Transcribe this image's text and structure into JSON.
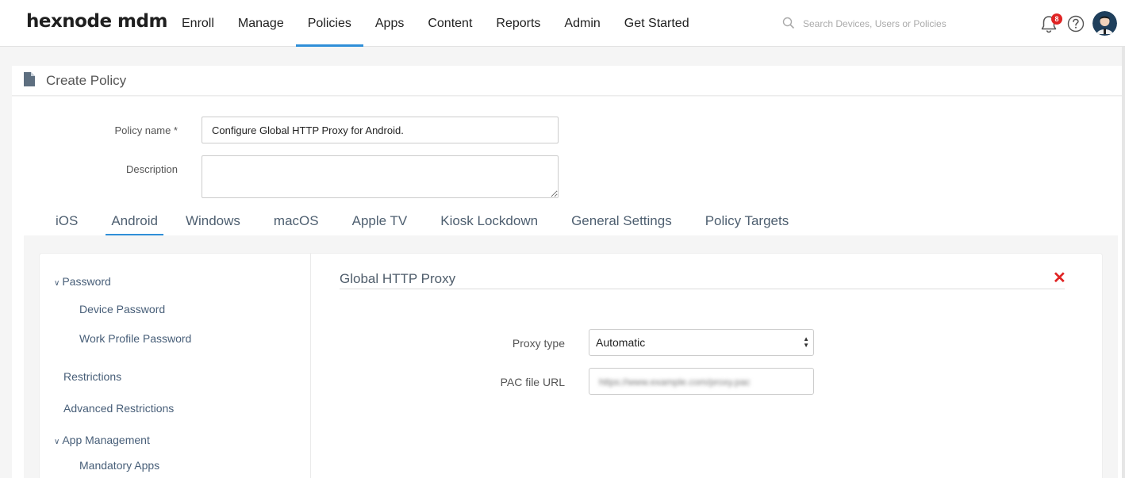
{
  "brand": {
    "logo": "hexnode mdm",
    "accent": "#2f8fd8"
  },
  "nav": {
    "items": [
      {
        "label": "Enroll",
        "active": false
      },
      {
        "label": "Manage",
        "active": false
      },
      {
        "label": "Policies",
        "active": true
      },
      {
        "label": "Apps",
        "active": false
      },
      {
        "label": "Content",
        "active": false
      },
      {
        "label": "Reports",
        "active": false
      },
      {
        "label": "Admin",
        "active": false
      },
      {
        "label": "Get Started",
        "active": false
      }
    ],
    "search_placeholder": "Search Devices, Users or Policies",
    "notification_count": "8",
    "icons": [
      "search-icon",
      "bell-icon",
      "help-icon",
      "avatar"
    ]
  },
  "page": {
    "title": "Create Policy"
  },
  "form": {
    "policy_name_label": "Policy name *",
    "policy_name_value": "Configure Global HTTP Proxy for Android.",
    "description_label": "Description",
    "description_value": ""
  },
  "platform_tabs": [
    {
      "label": "iOS",
      "active": false
    },
    {
      "label": "Android",
      "active": true
    },
    {
      "label": "Windows",
      "active": false
    },
    {
      "label": "macOS",
      "active": false
    },
    {
      "label": "Apple TV",
      "active": false
    },
    {
      "label": "Kiosk Lockdown",
      "active": false
    },
    {
      "label": "General Settings",
      "active": false
    },
    {
      "label": "Policy Targets",
      "active": false
    }
  ],
  "sidebar": {
    "items": [
      {
        "label": "Password",
        "expanded": true
      },
      {
        "label": "Device Password"
      },
      {
        "label": "Work Profile Password"
      },
      {
        "label": "Restrictions"
      },
      {
        "label": "Advanced Restrictions"
      },
      {
        "label": "App Management",
        "expanded": true
      },
      {
        "label": "Mandatory Apps"
      }
    ]
  },
  "section": {
    "title": "Global HTTP Proxy",
    "proxy_type_label": "Proxy type",
    "proxy_type_value": "Automatic",
    "pac_url_label": "PAC file URL",
    "pac_url_value": "https://www.example.com/proxy.pac"
  }
}
